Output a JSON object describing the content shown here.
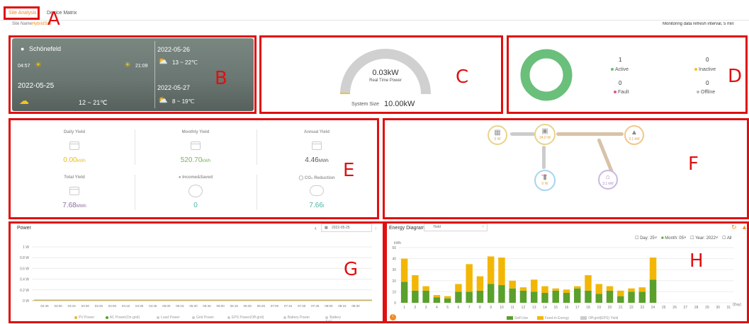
{
  "tabs": [
    "Site Analysis",
    "Device Matrix"
  ],
  "site_name_label": "Site Name:",
  "site_name_value": "HybridSite",
  "refresh_note": "Monitoring data refresh interval, 5 min",
  "annotations": {
    "A": "A",
    "B": "B",
    "C": "C",
    "D": "D",
    "E": "E",
    "F": "F",
    "G": "G",
    "H": "H"
  },
  "weather": {
    "location": "Schönefeld",
    "sunrise": "04:57",
    "sunset": "21:09",
    "today_date": "2022-05-25",
    "today_temp": "12 ~ 21℃",
    "day2_date": "2022-05-26",
    "day2_temp": "13 ~ 22℃",
    "day3_date": "2022-05-27",
    "day3_temp": "8 ~ 19℃"
  },
  "realtime": {
    "value": "0.03kW",
    "label": "Real Time Power",
    "size_label": "System Size",
    "size_value": "10.00kW",
    "fraction": 0.003
  },
  "status": {
    "active_count": "1",
    "active_label": "Active",
    "inactive_count": "0",
    "inactive_label": "Inactive",
    "fault_count": "0",
    "fault_label": "Fault",
    "offline_count": "0",
    "offline_label": "Offline",
    "colors": {
      "active": "#6abf7b",
      "inactive": "#f0c419",
      "fault": "#e9557a",
      "offline": "#bbbbbb"
    }
  },
  "yield": {
    "daily_label": "Daily Yield",
    "daily_value": "0.00",
    "daily_unit": "kWh",
    "monthly_label": "Monthly Yield",
    "monthly_value": "520.70",
    "monthly_unit": "kWh",
    "annual_label": "Annual Yield",
    "annual_value": "4.46",
    "annual_unit": "MWh",
    "total_label": "Total Yield",
    "total_value": "7.68",
    "total_unit": "MWh",
    "income_label": "Income&Saved",
    "income_value": "0",
    "co2_label": "CO₂ Reduction",
    "co2_value": "7.66",
    "co2_unit": "t",
    "colors": {
      "daily": "#e8b923",
      "monthly": "#79b35a",
      "annual": "#555555",
      "total": "#8a6d9e",
      "income": "#4bb5a5",
      "co2": "#4bb5a5"
    }
  },
  "flow": {
    "pv": "0 W",
    "inverter": "34.0 W",
    "grid": "3.1 kW",
    "battery": "0 W",
    "battery_soc": "94%",
    "home": "3.1 kW"
  },
  "power_chart": {
    "title": "Power",
    "date": "2022-05-25",
    "y_ticks": [
      "1 W",
      "0.8 W",
      "0.6 W",
      "0.4 W",
      "0.2 W",
      "0 W"
    ],
    "x_ticks": [
      "02:45",
      "03:00",
      "03:15",
      "03:30",
      "03:45",
      "04:00",
      "04:15",
      "04:30",
      "04:45",
      "05:00",
      "05:15",
      "05:30",
      "05:45",
      "06:00",
      "06:15",
      "06:30",
      "06:45",
      "07:00",
      "07:15",
      "07:30",
      "07:45",
      "08:00",
      "08:15",
      "08:30"
    ],
    "legend": [
      "PV Power",
      "AC Power(On-grid)",
      "Load Power",
      "Grid Power",
      "EPS Power(Off-grid)",
      "Battery Power",
      "Battery SoC"
    ]
  },
  "chart_data": {
    "type": "bar",
    "title": "Energy Diagram",
    "ylabel": "kWh",
    "ylim": [
      0,
      50
    ],
    "y_ticks": [
      0,
      10,
      20,
      30,
      40,
      50
    ],
    "categories": [
      "1",
      "2",
      "3",
      "4",
      "5",
      "6",
      "7",
      "8",
      "9",
      "10",
      "11",
      "12",
      "13",
      "14",
      "15",
      "16",
      "17",
      "18",
      "19",
      "20",
      "21",
      "22",
      "23",
      "24",
      "25",
      "26",
      "27",
      "28",
      "29",
      "30",
      "31"
    ],
    "series": [
      {
        "name": "Self-Use",
        "color": "#5aa02c",
        "values": [
          19,
          11,
          11,
          5,
          4,
          10,
          10,
          11,
          17,
          16,
          13,
          11,
          10,
          9,
          11,
          9,
          13,
          11,
          8,
          11,
          6,
          10,
          10,
          21,
          0,
          0,
          0,
          0,
          0,
          0,
          0
        ]
      },
      {
        "name": "Feed-in Energy",
        "color": "#f2b705",
        "values": [
          21,
          14,
          4,
          2,
          2,
          7,
          25,
          13,
          25,
          25,
          7,
          3,
          11,
          6,
          2,
          3,
          2,
          14,
          9,
          4,
          5,
          3,
          4,
          20,
          0,
          0,
          0,
          0,
          0,
          0,
          0
        ]
      },
      {
        "name": "Off-grid(EPS) Yield",
        "color": "#cccccc",
        "values": [
          0,
          0,
          0,
          0,
          0,
          0,
          0,
          0,
          0,
          0,
          0,
          0,
          0,
          0,
          0,
          0,
          0,
          0,
          0,
          0,
          0,
          0,
          0,
          0,
          0,
          0,
          0,
          0,
          0,
          0,
          0
        ]
      }
    ],
    "xunit": "(Day)",
    "dropdown": "Yield",
    "controls": {
      "day_label": "Day:",
      "day": "25",
      "month_label": "Month:",
      "month": "05",
      "year_label": "Year:",
      "year": "2022",
      "all_label": "All"
    }
  }
}
